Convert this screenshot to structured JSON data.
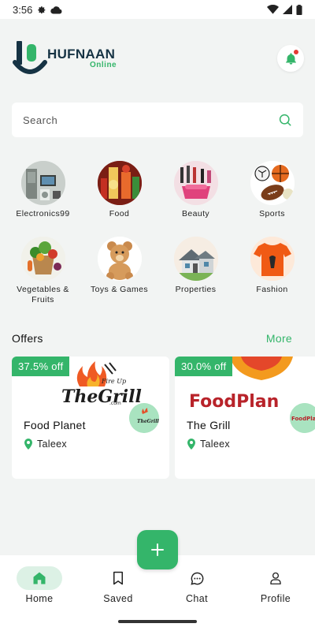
{
  "status_bar": {
    "time": "3:56"
  },
  "brand": {
    "name": "HUFNAAN",
    "sub": "Online",
    "color": "#34b56a",
    "dark": "#163344"
  },
  "search": {
    "placeholder": "Search"
  },
  "categories": [
    {
      "label": "Electronics99",
      "icon": "electronics-image"
    },
    {
      "label": "Food",
      "icon": "food-image"
    },
    {
      "label": "Beauty",
      "icon": "beauty-image"
    },
    {
      "label": "Sports",
      "icon": "sports-image"
    },
    {
      "label": "Vegetables & Fruits",
      "icon": "vegetables-image"
    },
    {
      "label": "Toys & Games",
      "icon": "teddy-bear-image"
    },
    {
      "label": "Properties",
      "icon": "house-image"
    },
    {
      "label": "Fashion",
      "icon": "tshirt-image"
    }
  ],
  "offers": {
    "title": "Offers",
    "more": "More",
    "items": [
      {
        "discount": "37.5% off",
        "name": "Food Planet",
        "location": "Taleex",
        "banner_top": "Fire Up",
        "banner_text": "TheGrill",
        "banner_sub": ".com"
      },
      {
        "discount": "30.0% off",
        "name": "The Grill",
        "location": "Taleex",
        "banner_text": "FoodPlan",
        "logo_text": "FoodPlan"
      }
    ]
  },
  "nav": [
    {
      "label": "Home",
      "icon": "home-icon",
      "active": true
    },
    {
      "label": "Saved",
      "icon": "bookmark-icon",
      "active": false
    },
    {
      "label": "Chat",
      "icon": "chat-icon",
      "active": false
    },
    {
      "label": "Profile",
      "icon": "profile-icon",
      "active": false
    }
  ]
}
